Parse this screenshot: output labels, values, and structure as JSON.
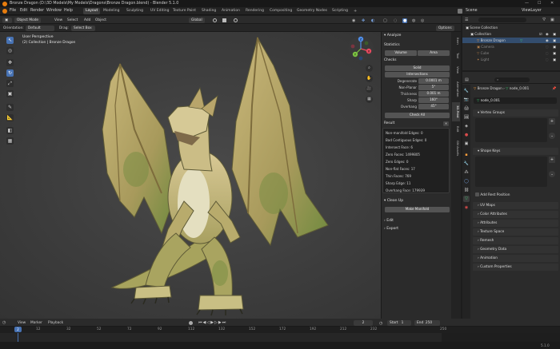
{
  "app": {
    "title": "Bronze Dragon (D:\\3D Models\\My Models\\Dragons\\Bronze Dragon.blend) - Blender 5.1.0",
    "version": "5.1.0"
  },
  "menu": {
    "items": [
      "File",
      "Edit",
      "Render",
      "Window",
      "Help"
    ],
    "workspaces": [
      "Layout",
      "Modeling",
      "Sculpting",
      "UV Editing",
      "Texture Paint",
      "Shading",
      "Animation",
      "Rendering",
      "Compositing",
      "Geometry Nodes",
      "Scripting"
    ],
    "active_workspace": "Layout",
    "scene_label": "Scene",
    "view_layer_label": "ViewLayer"
  },
  "viewport_header": {
    "mode": "Object Mode",
    "view": "View",
    "select": "Select",
    "add": "Add",
    "object": "Object",
    "orientation_label": "Orientation:",
    "orientation": "Default",
    "drag_label": "Drag:",
    "drag": "Select Box",
    "transform": "Global",
    "options": "Options"
  },
  "viewport": {
    "overlay_title": "User Perspective",
    "overlay_subtitle": "(2) Collection | Bronze Dragon",
    "gizmo": {
      "x": "X",
      "y": "Y",
      "z": "Z"
    }
  },
  "npanel": {
    "analyze": "Analyze",
    "statistics": "Statistics",
    "volume_btn": "Volume",
    "area_btn": "Area",
    "checks": "Checks",
    "solid": "Solid",
    "intersections": "Intersections",
    "rows": [
      {
        "label": "Degenerate",
        "value": "0.0001 m"
      },
      {
        "label": "Non-Planar",
        "value": "5°"
      },
      {
        "label": "Thickness",
        "value": "0.001 m"
      },
      {
        "label": "Sharp",
        "value": "160°"
      },
      {
        "label": "Overhang",
        "value": "45°"
      }
    ],
    "check_all": "Check All",
    "result_title": "Result",
    "results": [
      "Non-manifold Edges: 0",
      "Bad Contiguous Edges: 0",
      "Intersect Face: 6",
      "Zero Faces: 1499805",
      "Zero Edges: 0",
      "Non-flat Faces: 17",
      "Thin Faces: 769",
      "Sharp Edge: 11",
      "Overhang Face: 179939"
    ],
    "cleanup": "Clean Up",
    "make_manifold": "Make Manifold",
    "edit": "Edit",
    "export": "Export"
  },
  "side_tabs": [
    "Item",
    "Tool",
    "View",
    "Animation",
    "3D-Print",
    "Edit",
    "GN Assets"
  ],
  "outliner": {
    "root": "Scene Collection",
    "items": [
      {
        "name": "Collection",
        "indent": 1
      },
      {
        "name": "Bronze Dragon",
        "indent": 2
      },
      {
        "name": "Camera",
        "indent": 2
      },
      {
        "name": "Cube",
        "indent": 2
      },
      {
        "name": "Light",
        "indent": 2
      }
    ]
  },
  "properties": {
    "breadcrumb_object": "Bronze Dragon",
    "breadcrumb_mesh": "node_0.001",
    "mesh_name": "node_0.001",
    "vertex_groups": "Vertex Groups",
    "shape_keys": "Shape Keys",
    "add_rest_position": "Add Rest Position",
    "sections": [
      "UV Maps",
      "Color Attributes",
      "Attributes",
      "Texture Space",
      "Remesh",
      "Geometry Data",
      "Animation",
      "Custom Properties"
    ]
  },
  "timeline": {
    "playback": "Playback",
    "view": "View",
    "marker": "Marker",
    "current_frame": "2",
    "start_label": "Start",
    "start": "1",
    "end_label": "End",
    "end": "250",
    "ticks": [
      "2",
      "12",
      "32",
      "52",
      "72",
      "92",
      "112",
      "132",
      "152",
      "172",
      "192",
      "212",
      "232",
      "250"
    ]
  },
  "status": {
    "version": "5.1.0"
  },
  "colors": {
    "accent": "#4772b3",
    "mesh_icon": "#38c56f",
    "active_tab": "#3d3d3d"
  }
}
